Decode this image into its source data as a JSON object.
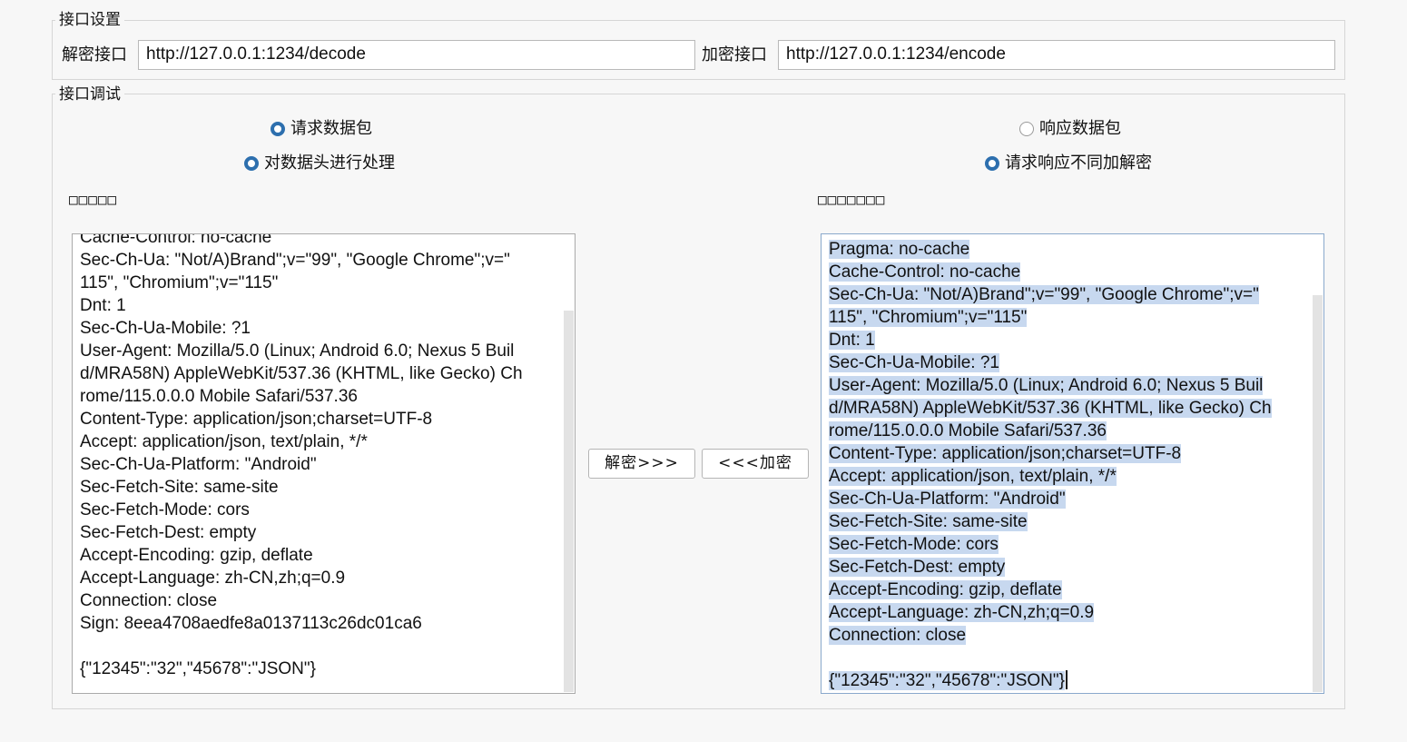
{
  "interface_settings": {
    "legend": "接口设置",
    "decode_label": "解密接口",
    "decode_url": "http://127.0.0.1:1234/decode",
    "encode_label": "加密接口",
    "encode_url": "http://127.0.0.1:1234/encode"
  },
  "interface_debug": {
    "legend": "接口调试",
    "radios": {
      "request_packet": {
        "label": "请求数据包",
        "checked": true
      },
      "response_packet": {
        "label": "响应数据包",
        "checked": false
      },
      "process_headers": {
        "label": "对数据头进行处理",
        "checked": true
      },
      "different_encrypt": {
        "label": "请求响应不同加解密",
        "checked": true
      }
    },
    "left_heading": "□□□□□",
    "right_heading": "□□□□□□□",
    "left_lines": [
      "Cache-Control: no-cache",
      "Sec-Ch-Ua: \"Not/A)Brand\";v=\"99\", \"Google Chrome\";v=\"",
      "115\", \"Chromium\";v=\"115\"",
      "Dnt: 1",
      "Sec-Ch-Ua-Mobile: ?1",
      "User-Agent: Mozilla/5.0 (Linux; Android 6.0; Nexus 5 Buil",
      "d/MRA58N) AppleWebKit/537.36 (KHTML, like Gecko) Ch",
      "rome/115.0.0.0 Mobile Safari/537.36",
      "Content-Type: application/json;charset=UTF-8",
      "Accept: application/json, text/plain, */*",
      "Sec-Ch-Ua-Platform: \"Android\"",
      "Sec-Fetch-Site: same-site",
      "Sec-Fetch-Mode: cors",
      "Sec-Fetch-Dest: empty",
      "Accept-Encoding: gzip, deflate",
      "Accept-Language: zh-CN,zh;q=0.9",
      "Connection: close",
      "Sign: 8eea4708aedfe8a0137113c26dc01ca6",
      "",
      "{\"12345\":\"32\",\"45678\":\"JSON\"}"
    ],
    "right_lines": [
      "Pragma: no-cache",
      "Cache-Control: no-cache",
      "Sec-Ch-Ua: \"Not/A)Brand\";v=\"99\", \"Google Chrome\";v=\"",
      "115\", \"Chromium\";v=\"115\"",
      "Dnt: 1",
      "Sec-Ch-Ua-Mobile: ?1",
      "User-Agent: Mozilla/5.0 (Linux; Android 6.0; Nexus 5 Buil",
      "d/MRA58N) AppleWebKit/537.36 (KHTML, like Gecko) Ch",
      "rome/115.0.0.0 Mobile Safari/537.36",
      "Content-Type: application/json;charset=UTF-8",
      "Accept: application/json, text/plain, */*",
      "Sec-Ch-Ua-Platform: \"Android\"",
      "Sec-Fetch-Site: same-site",
      "Sec-Fetch-Mode: cors",
      "Sec-Fetch-Dest: empty",
      "Accept-Encoding: gzip, deflate",
      "Accept-Language: zh-CN,zh;q=0.9",
      "Connection: close",
      "",
      "{\"12345\":\"32\",\"45678\":\"JSON\"}"
    ],
    "decrypt_button": "解密>>>",
    "encrypt_button": "<<<加密"
  },
  "colors": {
    "radio_accent": "#2d6fae",
    "selection": "#c7d8ef"
  }
}
